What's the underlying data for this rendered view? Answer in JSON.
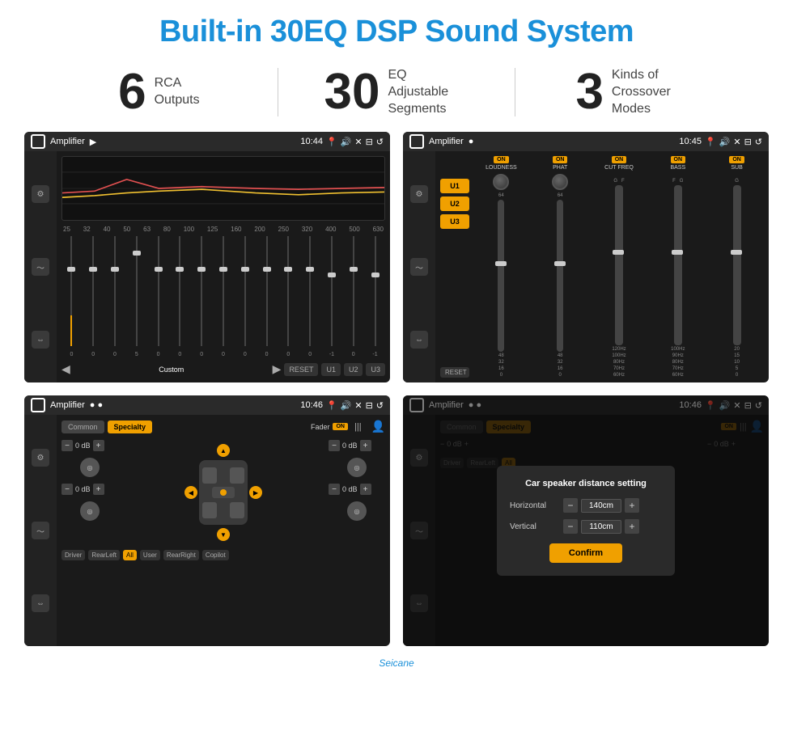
{
  "header": {
    "title": "Built-in 30EQ DSP Sound System",
    "title_color": "#1a90d9"
  },
  "stats": [
    {
      "number": "6",
      "label": "RCA\nOutputs"
    },
    {
      "number": "30",
      "label": "EQ Adjustable\nSegments"
    },
    {
      "number": "3",
      "label": "Kinds of\nCrossover Modes"
    }
  ],
  "screens": {
    "top_left": {
      "title": "Amplifier",
      "time": "10:44",
      "eq_freqs": [
        "25",
        "32",
        "40",
        "50",
        "63",
        "80",
        "100",
        "125",
        "160",
        "200",
        "250",
        "320",
        "400",
        "500",
        "630"
      ],
      "eq_values": [
        "0",
        "0",
        "0",
        "5",
        "0",
        "0",
        "0",
        "0",
        "0",
        "0",
        "0",
        "0",
        "-1",
        "0",
        "-1"
      ],
      "bottom_buttons": [
        "Custom",
        "RESET",
        "U1",
        "U2",
        "U3"
      ]
    },
    "top_right": {
      "title": "Amplifier",
      "time": "10:45",
      "presets": [
        "U1",
        "U2",
        "U3"
      ],
      "channels": [
        {
          "on": true,
          "label": "LOUDNESS"
        },
        {
          "on": true,
          "label": "PHAT"
        },
        {
          "on": true,
          "label": "CUT FREQ"
        },
        {
          "on": true,
          "label": "BASS"
        },
        {
          "on": true,
          "label": "SUB"
        }
      ],
      "reset_label": "RESET"
    },
    "bottom_left": {
      "title": "Amplifier",
      "time": "10:46",
      "tabs": [
        "Common",
        "Specialty"
      ],
      "active_tab": "Specialty",
      "fader_label": "Fader",
      "fader_on": "ON",
      "db_values": [
        "0 dB",
        "0 dB",
        "0 dB",
        "0 dB"
      ],
      "location_buttons": [
        "Driver",
        "RearLeft",
        "All",
        "User",
        "RearRight",
        "Copilot"
      ]
    },
    "bottom_right": {
      "title": "Amplifier",
      "time": "10:46",
      "dialog": {
        "title": "Car speaker distance setting",
        "horizontal_label": "Horizontal",
        "horizontal_value": "140cm",
        "vertical_label": "Vertical",
        "vertical_value": "110cm",
        "confirm_label": "Confirm"
      }
    }
  },
  "watermark": "Seicane"
}
